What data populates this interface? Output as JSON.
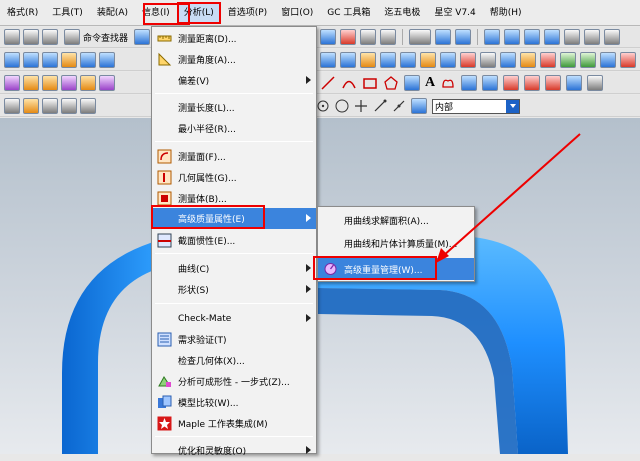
{
  "menubar": {
    "items": [
      "格式(R)",
      "工具(T)",
      "装配(A)",
      "信息(I)",
      "分析(L)",
      "首选项(P)",
      "窗口(O)",
      "GC 工具箱",
      "迄五电极",
      "星空 V7.4",
      "帮助(H)"
    ],
    "active_index": 4
  },
  "toolbar1": {
    "command_finder_label": "命令查找器"
  },
  "toolbar4": {
    "selection_dropdown_value": "内部"
  },
  "analysis_menu": {
    "items": [
      {
        "label": "测量距离(D)...",
        "icon": "measure-distance-icon"
      },
      {
        "label": "测量角度(A)...",
        "icon": "measure-angle-icon"
      },
      {
        "label": "偏差(V)",
        "submenu": true
      },
      {
        "label": "测量长度(L)...",
        "icon": "none"
      },
      {
        "label": "最小半径(R)...",
        "icon": "none"
      },
      {
        "label": "测量面(F)...",
        "icon": "measure-face-icon"
      },
      {
        "label": "几何属性(G)...",
        "icon": "geometric-properties-icon"
      },
      {
        "label": "测量体(B)...",
        "icon": "measure-body-icon"
      },
      {
        "label": "高级质量属性(E)",
        "submenu": true,
        "highlighted": true
      },
      {
        "label": "截面惯性(E)...",
        "icon": "section-inertia-icon"
      },
      {
        "label": "曲线(C)",
        "submenu": true
      },
      {
        "label": "形状(S)",
        "submenu": true
      },
      {
        "label": "Check-Mate",
        "submenu": true
      },
      {
        "label": "需求验证(T)",
        "icon": "requirements-validation-icon"
      },
      {
        "label": "检查几何体(X)...",
        "icon": "none"
      },
      {
        "label": "分析可成形性 - 一步式(Z)...",
        "icon": "one-step-formability-icon"
      },
      {
        "label": "模型比较(W)...",
        "icon": "model-compare-icon"
      },
      {
        "label": "Maple 工作表集成(M)",
        "icon": "maple-icon"
      },
      {
        "label": "优化和灵敏度(O)",
        "submenu": true
      }
    ]
  },
  "submenu": {
    "items": [
      {
        "label": "用曲线求解面积(A)..."
      },
      {
        "label": "用曲线和片体计算质量(M)..."
      },
      {
        "label": "高级重量管理(W)...",
        "highlighted": true
      }
    ]
  },
  "colors": {
    "menu_highlight": "#3b84dd",
    "annotation_red": "#e00000",
    "model_blue": "#1e90ff"
  }
}
